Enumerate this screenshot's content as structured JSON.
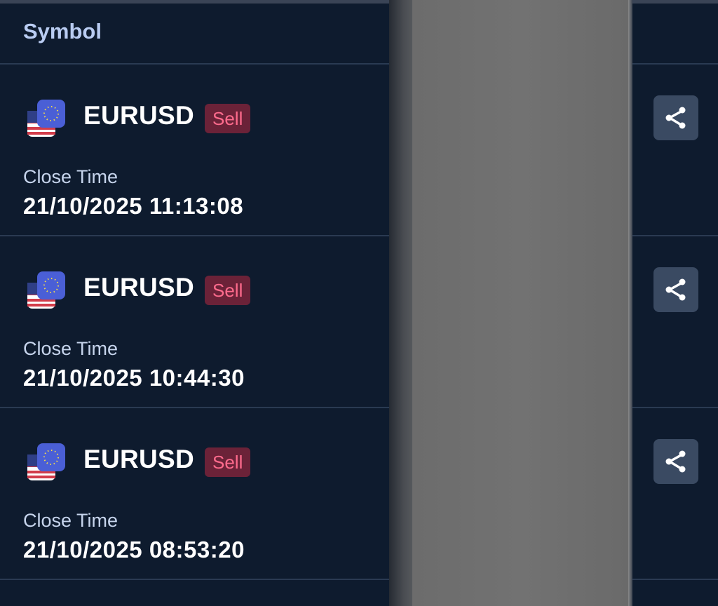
{
  "header": {
    "symbol_label": "Symbol"
  },
  "trades": [
    {
      "symbol": "EURUSD",
      "side": "Sell",
      "close_label": "Close Time",
      "close_time": "21/10/2025 11:13:08"
    },
    {
      "symbol": "EURUSD",
      "side": "Sell",
      "close_label": "Close Time",
      "close_time": "21/10/2025 10:44:30"
    },
    {
      "symbol": "EURUSD",
      "side": "Sell",
      "close_label": "Close Time",
      "close_time": "21/10/2025 08:53:20"
    }
  ],
  "icons": {
    "pair": "eurusd-flag-icon",
    "share": "share-icon"
  },
  "colors": {
    "background": "#0e1b2e",
    "sell_badge_bg": "#6b2238",
    "sell_badge_text": "#ff6b8d",
    "header_text": "#b9ccf2"
  }
}
